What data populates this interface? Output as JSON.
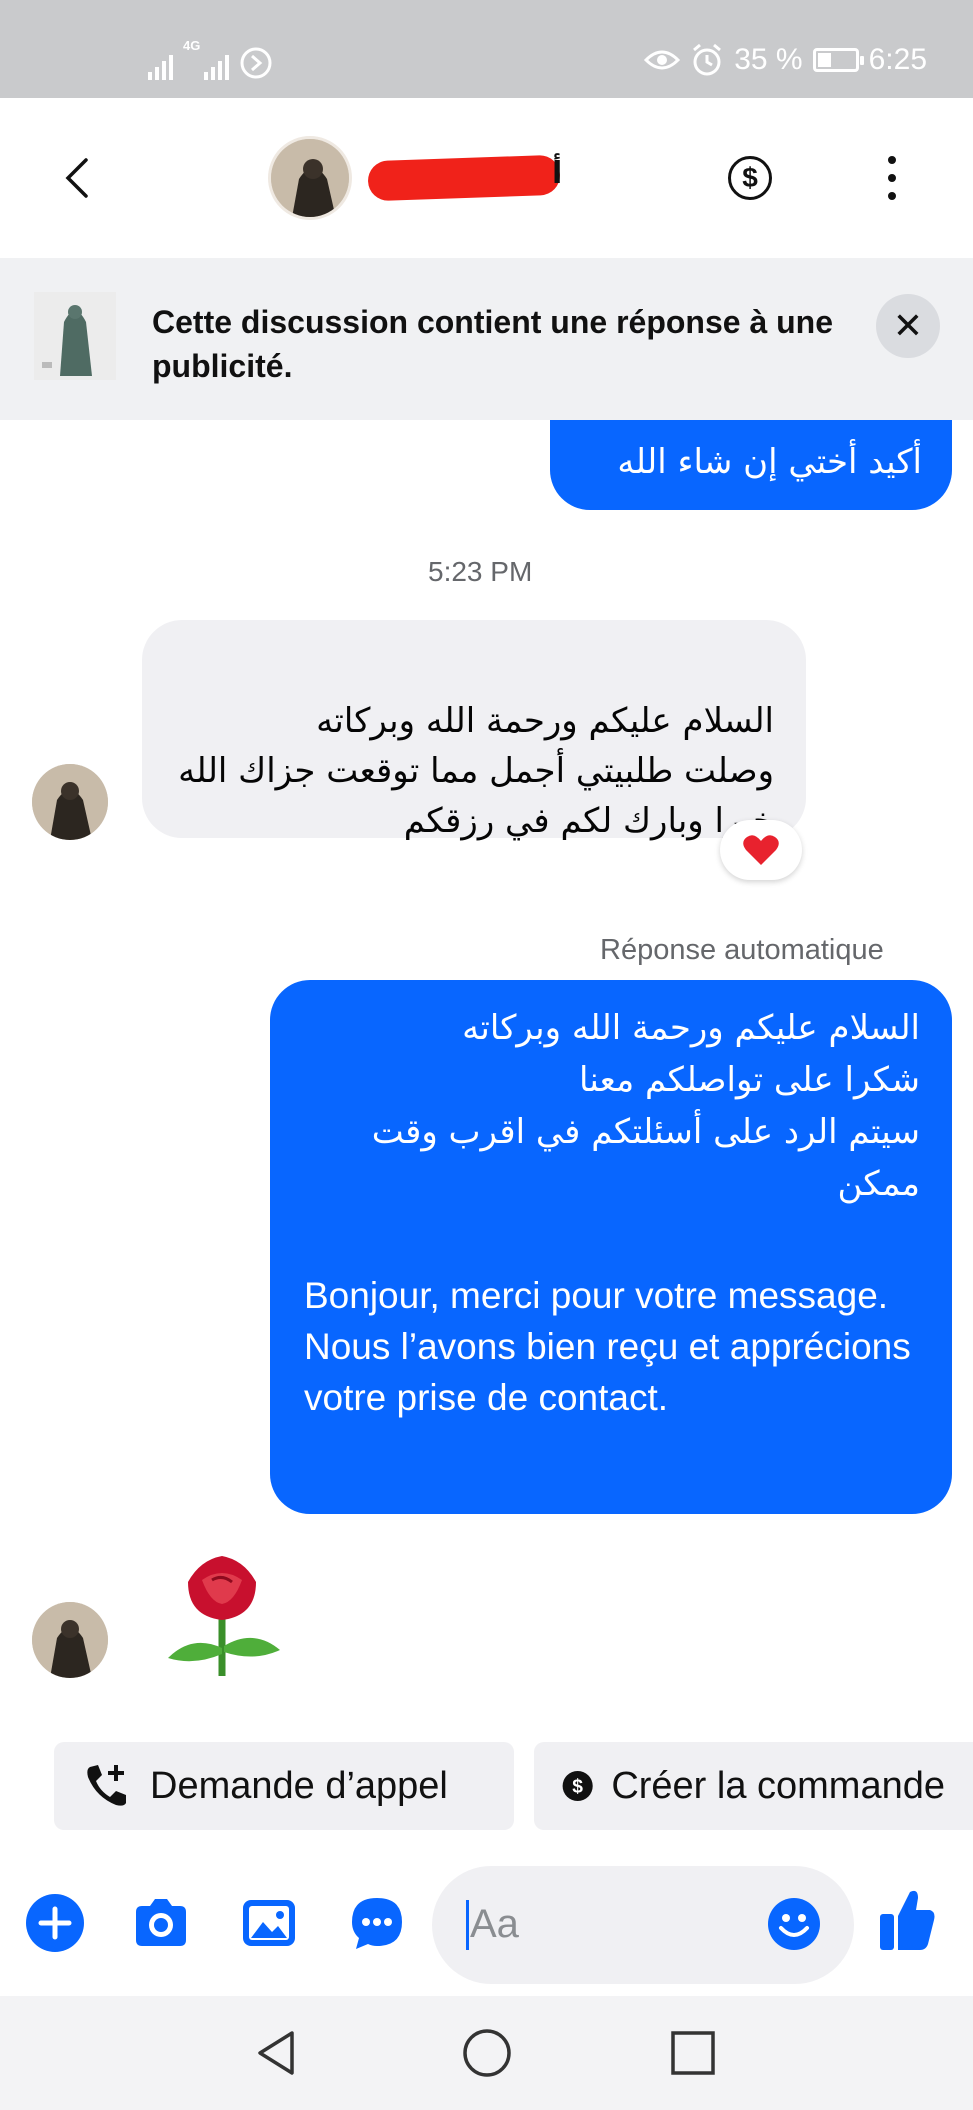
{
  "status_bar": {
    "network": "4G",
    "battery": "35 %",
    "battery_level": 0.35,
    "time": "6:25"
  },
  "header": {
    "name_visible_fragment": "أ",
    "icons": [
      "back-arrow-icon",
      "dollar-icon",
      "more-vertical-icon"
    ]
  },
  "banner": {
    "text": "Cette discussion contient une réponse à une publicité.",
    "close_label": "✕"
  },
  "messages": {
    "m1_text": "أكيد أختي إن شاء الله",
    "ts1": "5:23 PM",
    "m2_text": "السلام عليكم ورحمة  الله وبركاته\nوصلت طلبيتي  أجمل مما توقعت  جزاك الله خيرا وبارك لكم في رزقكم",
    "m2_reaction": "heart",
    "auto_label": "Réponse automatique",
    "m3_arabic": "السلام عليكم ورحمة الله وبركاته\nشكرا على تواصلكم معنا\nسيتم الرد على أسئلتكم في اقرب وقت ممكن",
    "m3_french": "Bonjour, merci pour votre message. Nous l’avons bien reçu et apprécions votre prise de contact.",
    "m4_emoji": "rose"
  },
  "quick_actions": {
    "call_request": "Demande d’appel",
    "create_order": "Créer la commande"
  },
  "composer": {
    "placeholder": "Aa",
    "icons": [
      "plus-icon",
      "camera-icon",
      "gallery-icon",
      "chat-more-icon",
      "emoji-icon",
      "thumbs-up-icon"
    ]
  },
  "colors": {
    "accent": "#0866ff",
    "incoming_bubble": "#f0f0f3",
    "status_bar": "#c9cacc",
    "redaction": "#f0221a"
  }
}
